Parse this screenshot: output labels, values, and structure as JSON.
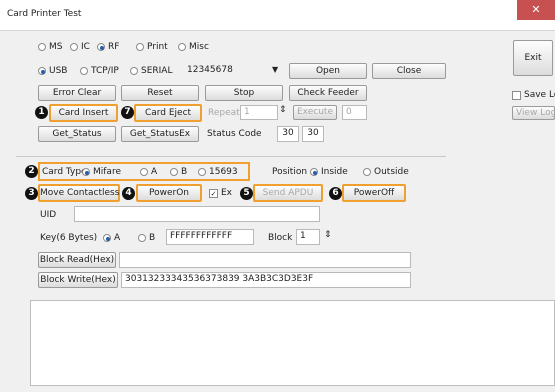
{
  "window": {
    "title": "Card Printer Test",
    "close_glyph": "✕"
  },
  "mode_radios": [
    {
      "label": "MS",
      "checked": false
    },
    {
      "label": "IC",
      "checked": false
    },
    {
      "label": "RF",
      "checked": true
    },
    {
      "label": "Print",
      "checked": false
    },
    {
      "label": "Misc",
      "checked": false
    }
  ],
  "interface_radios": [
    {
      "label": "USB",
      "checked": true
    },
    {
      "label": "TCP/IP",
      "checked": false
    },
    {
      "label": "SERIAL",
      "checked": false
    }
  ],
  "device_combo": {
    "value": "12345678"
  },
  "buttons": {
    "open": "Open",
    "close": "Close",
    "exit": "Exit",
    "error_clear": "Error Clear",
    "reset": "Reset",
    "stop": "Stop",
    "check_feeder": "Check Feeder",
    "card_insert": "Card Insert",
    "card_eject": "Card Eject",
    "execute": "Execute",
    "get_status": "Get_Status",
    "get_status_ex": "Get_StatusEx",
    "move_contactless": "Move Contactless",
    "power_on": "PowerOn",
    "send_apdu": "Send APDU",
    "power_off": "PowerOff",
    "block_read": "Block Read(Hex)",
    "block_write": "Block Write(Hex)",
    "view_log": "View Log"
  },
  "save_log": {
    "label": "Save Log",
    "checked": false
  },
  "repeat": {
    "label": "Repeat",
    "value": "1"
  },
  "execute_count": "0",
  "status_code": {
    "label": "Status Code",
    "value1": "30",
    "value2": "30"
  },
  "card_type": {
    "label": "Card Type",
    "options": [
      {
        "label": "Mifare",
        "checked": true
      },
      {
        "label": "A",
        "checked": false
      },
      {
        "label": "B",
        "checked": false
      },
      {
        "label": "15693",
        "checked": false
      }
    ]
  },
  "position": {
    "label": "Position",
    "options": [
      {
        "label": "Inside",
        "checked": true
      },
      {
        "label": "Outside",
        "checked": false
      }
    ]
  },
  "ex_checkbox": {
    "label": "Ex",
    "checked": true
  },
  "uid": {
    "label": "UID",
    "value": ""
  },
  "key": {
    "label": "Key(6 Bytes)",
    "options": [
      {
        "label": "A",
        "checked": true
      },
      {
        "label": "B",
        "checked": false
      }
    ],
    "value": "FFFFFFFFFFFF"
  },
  "block": {
    "label": "Block",
    "value": "1"
  },
  "block_read_value": "",
  "block_write_value": "30313233343536373839 3A3B3C3D3E3F",
  "markers": [
    "1",
    "7",
    "2",
    "3",
    "4",
    "5",
    "6"
  ],
  "highlight_color": "#f0a030"
}
